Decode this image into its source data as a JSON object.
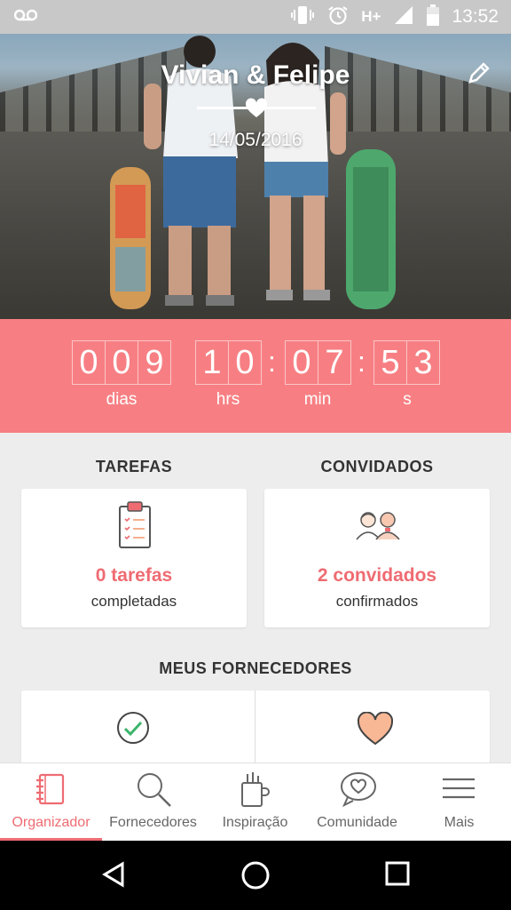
{
  "status_bar": {
    "time": "13:52",
    "network": "H+"
  },
  "hero": {
    "title": "Vivian & Felipe",
    "date": "14/05/2016"
  },
  "countdown": {
    "days": [
      "0",
      "0",
      "9"
    ],
    "hours": [
      "1",
      "0"
    ],
    "minutes": [
      "0",
      "7"
    ],
    "seconds": [
      "5",
      "3"
    ],
    "separator": ":",
    "labels": {
      "days": "dias",
      "hours": "hrs",
      "minutes": "min",
      "seconds": "s"
    }
  },
  "tasks": {
    "title": "TAREFAS",
    "main": "0 tarefas",
    "sub": "completadas"
  },
  "guests": {
    "title": "CONVIDADOS",
    "main": "2 convidados",
    "sub": "confirmados"
  },
  "vendors": {
    "title": "MEUS FORNECEDORES"
  },
  "tabs": [
    {
      "label": "Organizador",
      "icon": "notebook-icon",
      "active": true
    },
    {
      "label": "Fornecedores",
      "icon": "search-icon",
      "active": false
    },
    {
      "label": "Inspiração",
      "icon": "inspiration-icon",
      "active": false
    },
    {
      "label": "Comunidade",
      "icon": "community-icon",
      "active": false
    },
    {
      "label": "Mais",
      "icon": "menu-icon",
      "active": false
    }
  ],
  "colors": {
    "accent": "#ef6b72",
    "countdown_bg": "#f77f83"
  }
}
